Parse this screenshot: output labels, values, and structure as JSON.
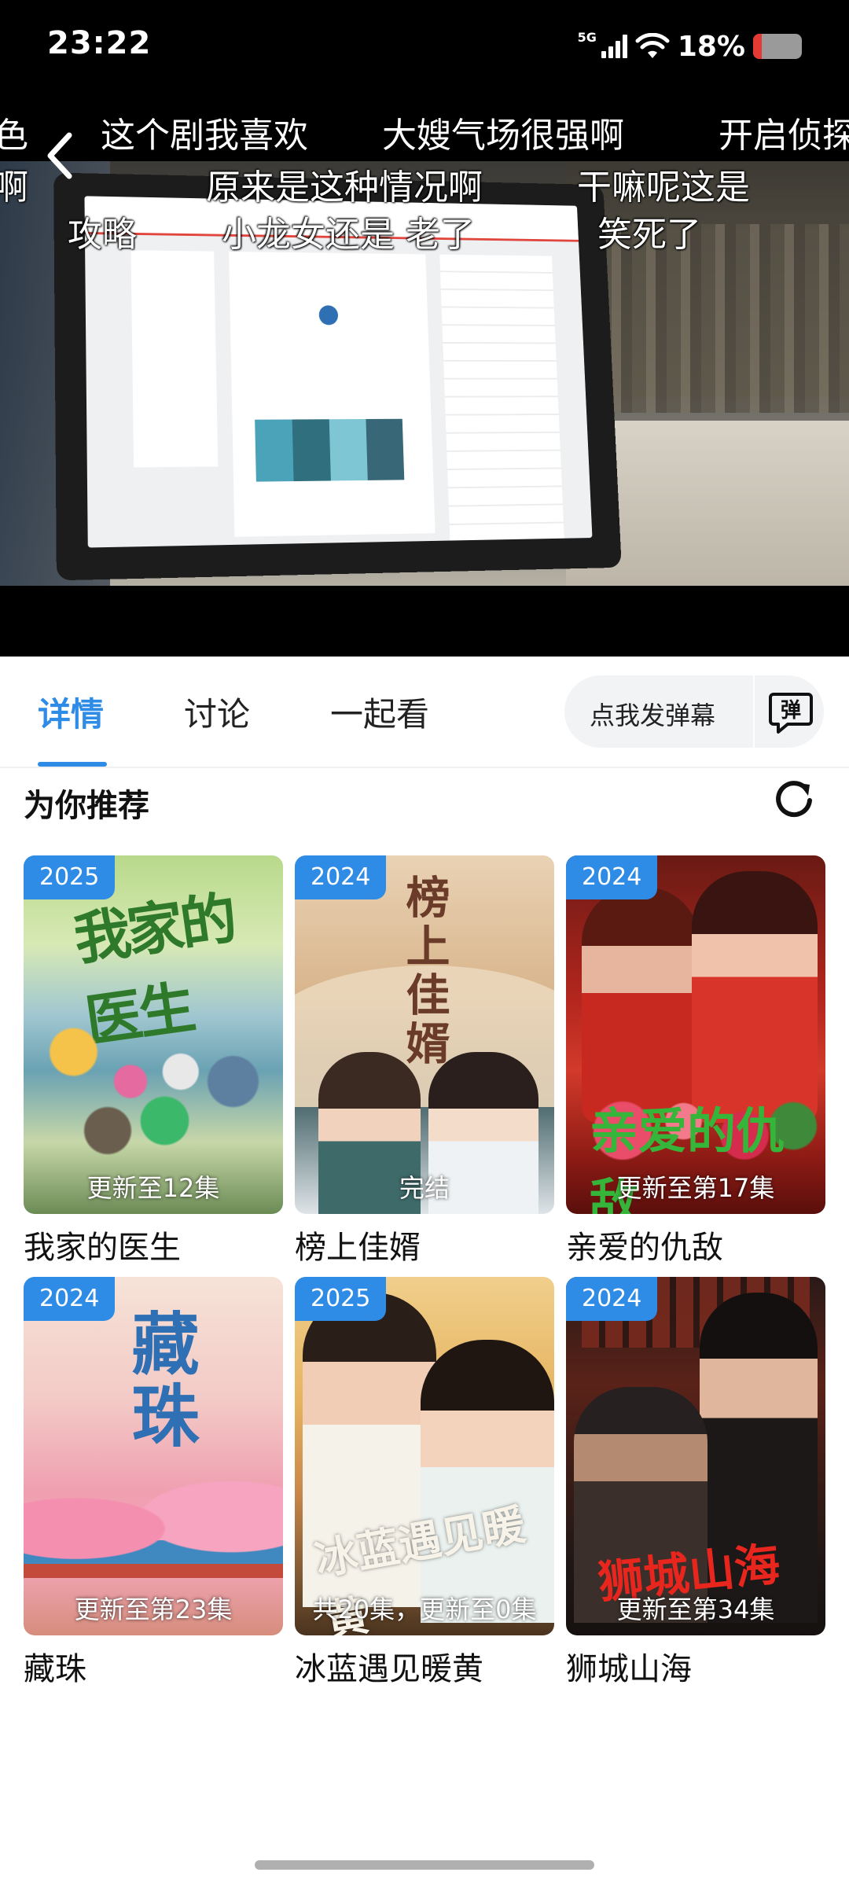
{
  "status_bar": {
    "time": "23:22",
    "network": "5G",
    "battery_percent": "18%",
    "battery_level": 0.18,
    "battery_color": "#e53935"
  },
  "video": {
    "back_icon": "chevron-left-icon",
    "danmaku": [
      "色",
      "啊",
      "这个剧我喜欢",
      "大嫂气场很强啊",
      "开启侦探",
      "原来是这种情况啊",
      "干嘛呢这是",
      "攻略",
      "小龙女还是 老了",
      "笑死了"
    ]
  },
  "tabs": {
    "items": [
      "详情",
      "讨论",
      "一起看"
    ],
    "active_index": 0,
    "accent_color": "#2f8ce6",
    "danmu_input_placeholder": "点我发弹幕",
    "danmu_icon_label": "弹"
  },
  "recommend": {
    "title": "为你推荐",
    "refresh_icon": "refresh-icon",
    "items": [
      {
        "title": "我家的医生",
        "year": "2025",
        "episodes": "更新至12集"
      },
      {
        "title": "榜上佳婿",
        "year": "2024",
        "episodes": "完结"
      },
      {
        "title": "亲爱的仇敌",
        "year": "2024",
        "episodes": "更新至第17集"
      },
      {
        "title": "藏珠",
        "year": "2024",
        "episodes": "更新至第23集"
      },
      {
        "title": "冰蓝遇见暖黄",
        "year": "2025",
        "episodes": "共20集，更新至0集"
      },
      {
        "title": "狮城山海",
        "year": "2024",
        "episodes": "更新至第34集"
      }
    ]
  }
}
